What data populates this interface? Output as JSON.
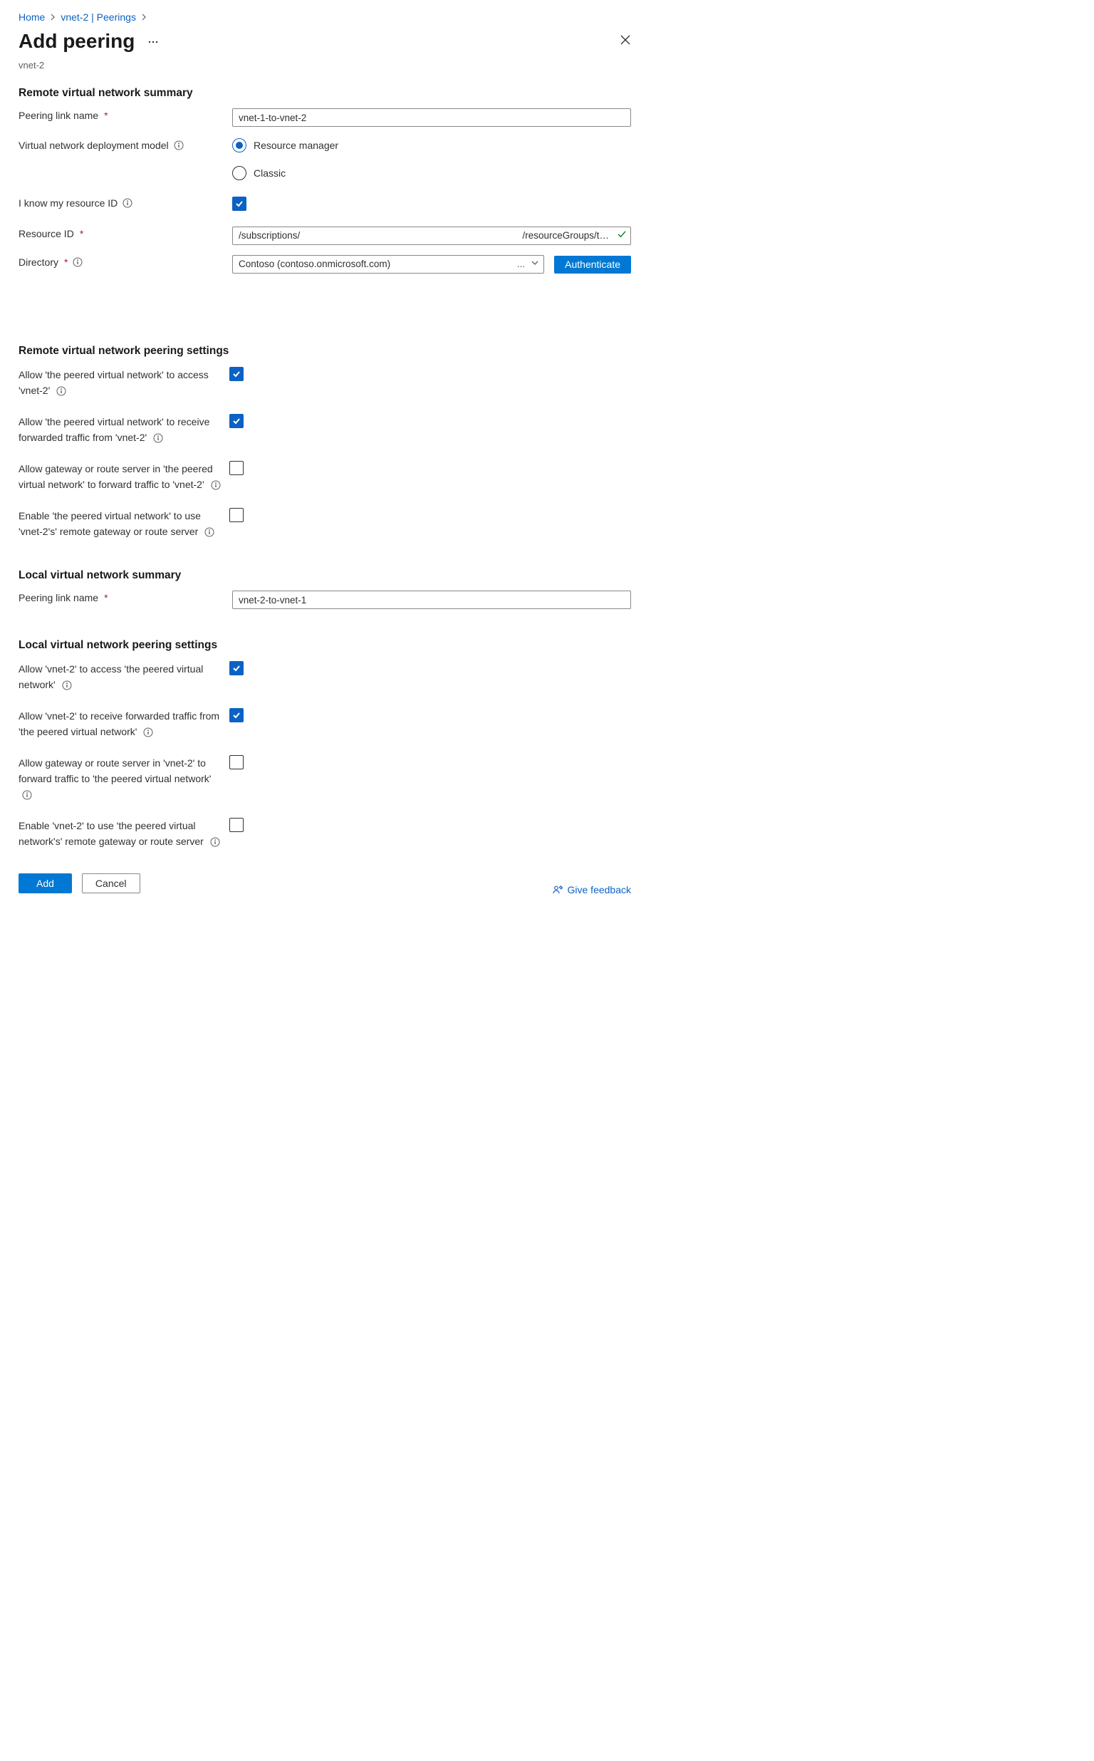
{
  "breadcrumbs": {
    "home": "Home",
    "vnet_peerings": "vnet-2 | Peerings"
  },
  "header": {
    "title": "Add peering",
    "subtitle": "vnet-2"
  },
  "remote_summary": {
    "title": "Remote virtual network summary",
    "peering_link_name_label": "Peering link name",
    "peering_link_name_value": "vnet-1-to-vnet-2",
    "deployment_model_label": "Virtual network deployment model",
    "deployment_options": {
      "resource_manager": "Resource manager",
      "classic": "Classic",
      "selected": "resource_manager"
    },
    "know_resource_id_label": "I know my resource ID",
    "know_resource_id_checked": true,
    "resource_id_label": "Resource ID",
    "resource_id_prefix": "/subscriptions/",
    "resource_id_suffix": "/resourceGroups/t…",
    "directory_label": "Directory",
    "directory_value": "Contoso (contoso.onmicrosoft.com)",
    "directory_ellipsis": "...",
    "authenticate_label": "Authenticate"
  },
  "remote_settings": {
    "title": "Remote virtual network peering settings",
    "allow_access_label": "Allow 'the peered virtual network' to access 'vnet-2'",
    "allow_access_checked": true,
    "allow_forwarded_label": "Allow 'the peered virtual network' to receive forwarded traffic from 'vnet-2'",
    "allow_forwarded_checked": true,
    "allow_gateway_label": "Allow gateway or route server in 'the peered virtual network' to forward traffic to 'vnet-2'",
    "allow_gateway_checked": false,
    "use_remote_gateway_label": "Enable 'the peered virtual network' to use 'vnet-2's' remote gateway or route server",
    "use_remote_gateway_checked": false
  },
  "local_summary": {
    "title": "Local virtual network summary",
    "peering_link_name_label": "Peering link name",
    "peering_link_name_value": "vnet-2-to-vnet-1"
  },
  "local_settings": {
    "title": "Local virtual network peering settings",
    "allow_access_label": "Allow 'vnet-2' to access 'the peered virtual network'",
    "allow_access_checked": true,
    "allow_forwarded_label": "Allow 'vnet-2' to receive forwarded traffic from 'the peered virtual network'",
    "allow_forwarded_checked": true,
    "allow_gateway_label": "Allow gateway or route server in 'vnet-2' to forward traffic to 'the peered virtual network'",
    "allow_gateway_checked": false,
    "use_remote_gateway_label": "Enable 'vnet-2' to use 'the peered virtual network's' remote gateway or route server",
    "use_remote_gateway_checked": false
  },
  "footer": {
    "add": "Add",
    "cancel": "Cancel",
    "feedback": "Give feedback"
  }
}
